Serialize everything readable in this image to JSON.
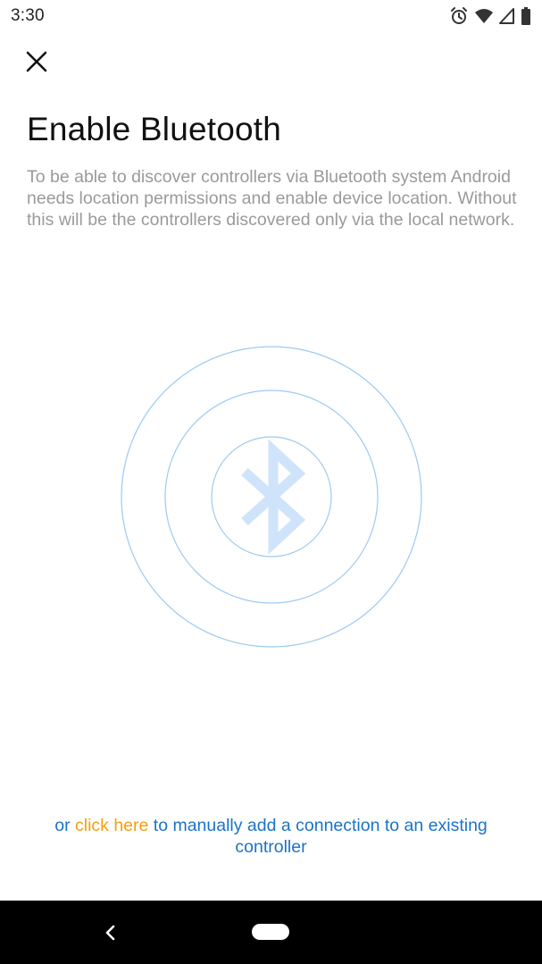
{
  "status_bar": {
    "time": "3:30",
    "icons": [
      "alarm-icon",
      "wifi-icon",
      "signal-icon",
      "battery-icon"
    ]
  },
  "header": {
    "close_icon": "close-icon",
    "title": "Enable Bluetooth"
  },
  "description": "To be able to discover controllers via Bluetooth system Android needs location permissions and enable device location. Without this will be the controllers discovered only via the local network.",
  "illustration": {
    "icon": "bluetooth-icon",
    "ring_color": "#9ccaf2",
    "icon_color": "#cfe3fb"
  },
  "manual_link": {
    "prefix": "or",
    "link": "click here",
    "suffix": "to manually add a connection to an existing controller"
  },
  "colors": {
    "accent_blue": "#1a73c9",
    "accent_orange": "#f5a00e",
    "description_gray": "#9a9a9a"
  },
  "nav_bar": {
    "back_icon": "back-chevron-icon",
    "home_icon": "home-pill-icon"
  }
}
